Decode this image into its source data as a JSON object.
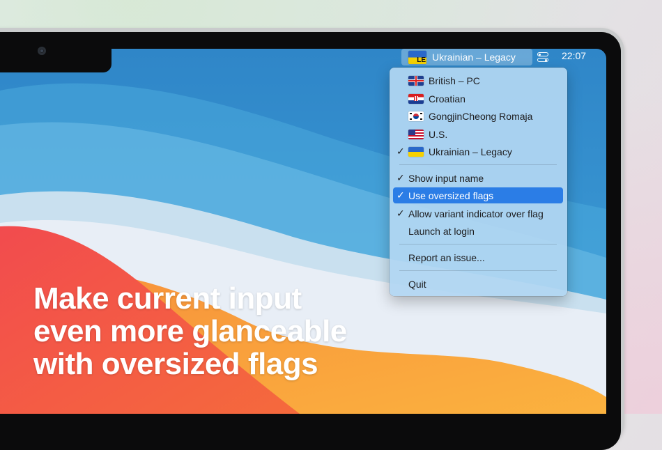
{
  "menubar": {
    "status_item_label": "Ukrainian – Legacy",
    "status_flag": "ua-flag-icon",
    "variant_indicator": "LE",
    "clock": "22:07"
  },
  "menu": {
    "inputs": [
      {
        "label": "British – PC",
        "flag": "gb-flag-icon",
        "checked": false
      },
      {
        "label": "Croatian",
        "flag": "hr-flag-icon",
        "checked": false
      },
      {
        "label": "GongjinCheong Romaja",
        "flag": "kr-flag-icon",
        "checked": false
      },
      {
        "label": "U.S.",
        "flag": "us-flag-icon",
        "checked": false
      },
      {
        "label": "Ukrainian – Legacy",
        "flag": "ua-flag-icon",
        "checked": true
      }
    ],
    "options": [
      {
        "label": "Show input name",
        "checked": true,
        "highlighted": false
      },
      {
        "label": "Use oversized flags",
        "checked": true,
        "highlighted": true
      },
      {
        "label": "Allow variant indicator over flag",
        "checked": true,
        "highlighted": false
      },
      {
        "label": "Launch at login",
        "checked": false,
        "highlighted": false
      }
    ],
    "report": "Report an issue...",
    "quit": "Quit",
    "check_glyph": "✓"
  },
  "headline": {
    "line1": "Make current input",
    "line2": "even more glanceable",
    "line3": "with oversized flags"
  },
  "colors": {
    "highlight": "#2b7de6",
    "menu_bg": "#b2d6f2"
  }
}
